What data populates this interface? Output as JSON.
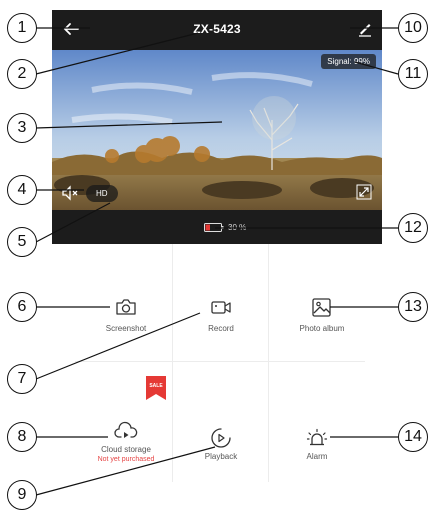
{
  "header": {
    "title": "ZX-5423",
    "back_icon": "back-arrow-icon",
    "edit_icon": "pencil-icon"
  },
  "video": {
    "signal": "Signal: 99%",
    "hd_label": "HD",
    "speaker_icon": "speaker-mute-icon",
    "fullscreen_icon": "fullscreen-icon"
  },
  "status": {
    "battery_text": "30 %",
    "battery_level": 0.3,
    "battery_color": "#e53935"
  },
  "grid": {
    "screenshot": "Screenshot",
    "record": "Record",
    "photo_album": "Photo album",
    "cloud_storage": "Cloud storage",
    "cloud_status": "Not yet purchased",
    "playback": "Playback",
    "alarm": "Alarm",
    "sale_badge": "SALE"
  },
  "callouts": [
    "1",
    "2",
    "3",
    "4",
    "5",
    "6",
    "7",
    "8",
    "9",
    "10",
    "11",
    "12",
    "13",
    "14"
  ],
  "colors": {
    "app_bg": "#1c1c1c",
    "accent_red": "#e53935",
    "badge_red": "#e53935"
  }
}
